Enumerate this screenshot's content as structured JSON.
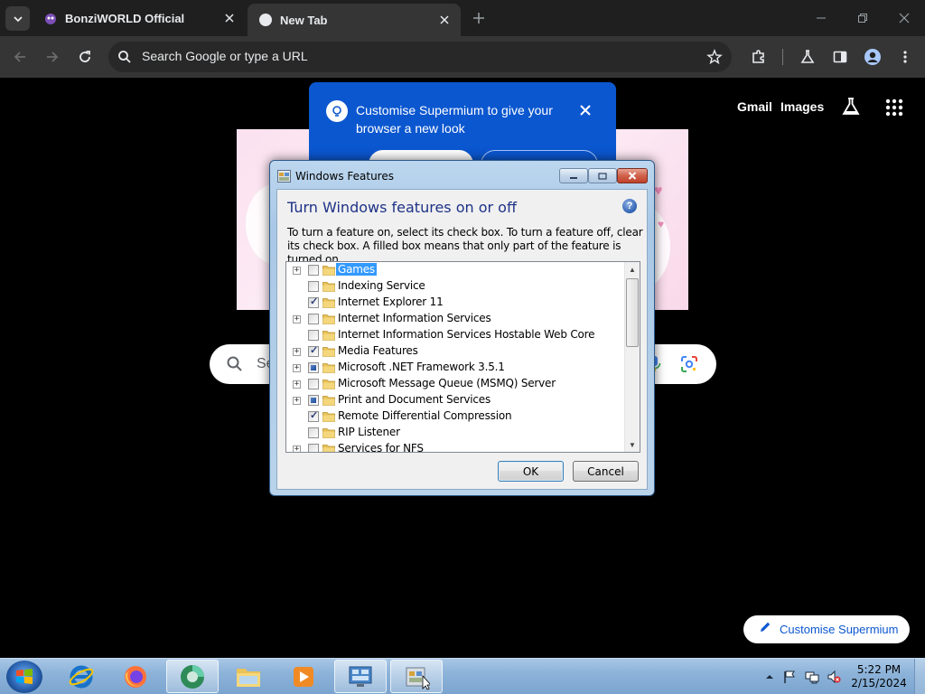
{
  "browser": {
    "tabs": [
      {
        "title": "BonziWORLD Official",
        "active": false
      },
      {
        "title": "New Tab",
        "active": true
      }
    ],
    "omnibox_placeholder": "Search Google or type a URL"
  },
  "ntp": {
    "links": {
      "gmail": "Gmail",
      "images": "Images"
    },
    "search_placeholder": "Se",
    "promo_text": "Customise Supermium to give your browser a new look",
    "customise_label": "Customise Supermium"
  },
  "dialog": {
    "title": "Windows Features",
    "heading": "Turn Windows features on or off",
    "description": "To turn a feature on, select its check box. To turn a feature off, clear its check box. A filled box means that only part of the feature is turned on.",
    "features": [
      {
        "label": "Games",
        "state": "unchecked",
        "expandable": true,
        "selected": true
      },
      {
        "label": "Indexing Service",
        "state": "unchecked",
        "expandable": false,
        "selected": false
      },
      {
        "label": "Internet Explorer 11",
        "state": "checked",
        "expandable": false,
        "selected": false
      },
      {
        "label": "Internet Information Services",
        "state": "unchecked",
        "expandable": true,
        "selected": false
      },
      {
        "label": "Internet Information Services Hostable Web Core",
        "state": "unchecked",
        "expandable": false,
        "selected": false
      },
      {
        "label": "Media Features",
        "state": "checked",
        "expandable": true,
        "selected": false
      },
      {
        "label": "Microsoft .NET Framework 3.5.1",
        "state": "partial",
        "expandable": true,
        "selected": false
      },
      {
        "label": "Microsoft Message Queue (MSMQ) Server",
        "state": "unchecked",
        "expandable": true,
        "selected": false
      },
      {
        "label": "Print and Document Services",
        "state": "partial",
        "expandable": true,
        "selected": false
      },
      {
        "label": "Remote Differential Compression",
        "state": "checked",
        "expandable": false,
        "selected": false
      },
      {
        "label": "RIP Listener",
        "state": "unchecked",
        "expandable": false,
        "selected": false
      },
      {
        "label": "Services for NFS",
        "state": "unchecked",
        "expandable": true,
        "selected": false
      }
    ],
    "ok_label": "OK",
    "cancel_label": "Cancel"
  },
  "taskbar": {
    "time": "5:22 PM",
    "date": "2/15/2024",
    "pinned_apps": [
      "internet-explorer",
      "firefox",
      "supermium",
      "file-explorer",
      "media-player",
      "control-panel",
      "windows-features"
    ]
  },
  "colors": {
    "promo_bg": "#0b57d0",
    "dialog_heading": "#1e3287",
    "selection": "#3399ff"
  }
}
